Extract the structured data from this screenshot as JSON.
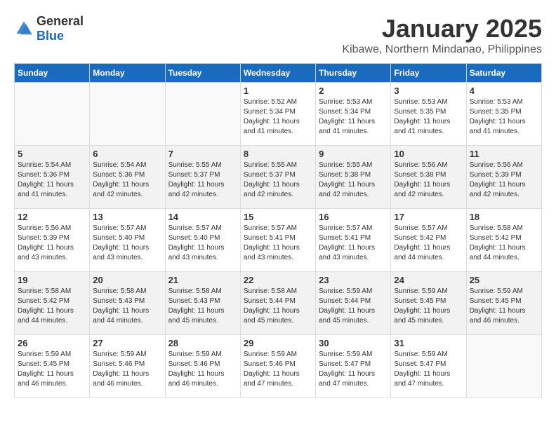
{
  "logo": {
    "text_general": "General",
    "text_blue": "Blue"
  },
  "title": {
    "month": "January 2025",
    "location": "Kibawe, Northern Mindanao, Philippines"
  },
  "weekdays": [
    "Sunday",
    "Monday",
    "Tuesday",
    "Wednesday",
    "Thursday",
    "Friday",
    "Saturday"
  ],
  "weeks": [
    [
      {
        "day": "",
        "sunrise": "",
        "sunset": "",
        "daylight": "",
        "empty": true
      },
      {
        "day": "",
        "sunrise": "",
        "sunset": "",
        "daylight": "",
        "empty": true
      },
      {
        "day": "",
        "sunrise": "",
        "sunset": "",
        "daylight": "",
        "empty": true
      },
      {
        "day": "1",
        "sunrise": "Sunrise: 5:52 AM",
        "sunset": "Sunset: 5:34 PM",
        "daylight": "Daylight: 11 hours and 41 minutes."
      },
      {
        "day": "2",
        "sunrise": "Sunrise: 5:53 AM",
        "sunset": "Sunset: 5:34 PM",
        "daylight": "Daylight: 11 hours and 41 minutes."
      },
      {
        "day": "3",
        "sunrise": "Sunrise: 5:53 AM",
        "sunset": "Sunset: 5:35 PM",
        "daylight": "Daylight: 11 hours and 41 minutes."
      },
      {
        "day": "4",
        "sunrise": "Sunrise: 5:53 AM",
        "sunset": "Sunset: 5:35 PM",
        "daylight": "Daylight: 11 hours and 41 minutes."
      }
    ],
    [
      {
        "day": "5",
        "sunrise": "Sunrise: 5:54 AM",
        "sunset": "Sunset: 5:36 PM",
        "daylight": "Daylight: 11 hours and 41 minutes."
      },
      {
        "day": "6",
        "sunrise": "Sunrise: 5:54 AM",
        "sunset": "Sunset: 5:36 PM",
        "daylight": "Daylight: 11 hours and 42 minutes."
      },
      {
        "day": "7",
        "sunrise": "Sunrise: 5:55 AM",
        "sunset": "Sunset: 5:37 PM",
        "daylight": "Daylight: 11 hours and 42 minutes."
      },
      {
        "day": "8",
        "sunrise": "Sunrise: 5:55 AM",
        "sunset": "Sunset: 5:37 PM",
        "daylight": "Daylight: 11 hours and 42 minutes."
      },
      {
        "day": "9",
        "sunrise": "Sunrise: 5:55 AM",
        "sunset": "Sunset: 5:38 PM",
        "daylight": "Daylight: 11 hours and 42 minutes."
      },
      {
        "day": "10",
        "sunrise": "Sunrise: 5:56 AM",
        "sunset": "Sunset: 5:38 PM",
        "daylight": "Daylight: 11 hours and 42 minutes."
      },
      {
        "day": "11",
        "sunrise": "Sunrise: 5:56 AM",
        "sunset": "Sunset: 5:39 PM",
        "daylight": "Daylight: 11 hours and 42 minutes."
      }
    ],
    [
      {
        "day": "12",
        "sunrise": "Sunrise: 5:56 AM",
        "sunset": "Sunset: 5:39 PM",
        "daylight": "Daylight: 11 hours and 43 minutes."
      },
      {
        "day": "13",
        "sunrise": "Sunrise: 5:57 AM",
        "sunset": "Sunset: 5:40 PM",
        "daylight": "Daylight: 11 hours and 43 minutes."
      },
      {
        "day": "14",
        "sunrise": "Sunrise: 5:57 AM",
        "sunset": "Sunset: 5:40 PM",
        "daylight": "Daylight: 11 hours and 43 minutes."
      },
      {
        "day": "15",
        "sunrise": "Sunrise: 5:57 AM",
        "sunset": "Sunset: 5:41 PM",
        "daylight": "Daylight: 11 hours and 43 minutes."
      },
      {
        "day": "16",
        "sunrise": "Sunrise: 5:57 AM",
        "sunset": "Sunset: 5:41 PM",
        "daylight": "Daylight: 11 hours and 43 minutes."
      },
      {
        "day": "17",
        "sunrise": "Sunrise: 5:57 AM",
        "sunset": "Sunset: 5:42 PM",
        "daylight": "Daylight: 11 hours and 44 minutes."
      },
      {
        "day": "18",
        "sunrise": "Sunrise: 5:58 AM",
        "sunset": "Sunset: 5:42 PM",
        "daylight": "Daylight: 11 hours and 44 minutes."
      }
    ],
    [
      {
        "day": "19",
        "sunrise": "Sunrise: 5:58 AM",
        "sunset": "Sunset: 5:42 PM",
        "daylight": "Daylight: 11 hours and 44 minutes."
      },
      {
        "day": "20",
        "sunrise": "Sunrise: 5:58 AM",
        "sunset": "Sunset: 5:43 PM",
        "daylight": "Daylight: 11 hours and 44 minutes."
      },
      {
        "day": "21",
        "sunrise": "Sunrise: 5:58 AM",
        "sunset": "Sunset: 5:43 PM",
        "daylight": "Daylight: 11 hours and 45 minutes."
      },
      {
        "day": "22",
        "sunrise": "Sunrise: 5:58 AM",
        "sunset": "Sunset: 5:44 PM",
        "daylight": "Daylight: 11 hours and 45 minutes."
      },
      {
        "day": "23",
        "sunrise": "Sunrise: 5:59 AM",
        "sunset": "Sunset: 5:44 PM",
        "daylight": "Daylight: 11 hours and 45 minutes."
      },
      {
        "day": "24",
        "sunrise": "Sunrise: 5:59 AM",
        "sunset": "Sunset: 5:45 PM",
        "daylight": "Daylight: 11 hours and 45 minutes."
      },
      {
        "day": "25",
        "sunrise": "Sunrise: 5:59 AM",
        "sunset": "Sunset: 5:45 PM",
        "daylight": "Daylight: 11 hours and 46 minutes."
      }
    ],
    [
      {
        "day": "26",
        "sunrise": "Sunrise: 5:59 AM",
        "sunset": "Sunset: 5:45 PM",
        "daylight": "Daylight: 11 hours and 46 minutes."
      },
      {
        "day": "27",
        "sunrise": "Sunrise: 5:59 AM",
        "sunset": "Sunset: 5:46 PM",
        "daylight": "Daylight: 11 hours and 46 minutes."
      },
      {
        "day": "28",
        "sunrise": "Sunrise: 5:59 AM",
        "sunset": "Sunset: 5:46 PM",
        "daylight": "Daylight: 11 hours and 46 minutes."
      },
      {
        "day": "29",
        "sunrise": "Sunrise: 5:59 AM",
        "sunset": "Sunset: 5:46 PM",
        "daylight": "Daylight: 11 hours and 47 minutes."
      },
      {
        "day": "30",
        "sunrise": "Sunrise: 5:59 AM",
        "sunset": "Sunset: 5:47 PM",
        "daylight": "Daylight: 11 hours and 47 minutes."
      },
      {
        "day": "31",
        "sunrise": "Sunrise: 5:59 AM",
        "sunset": "Sunset: 5:47 PM",
        "daylight": "Daylight: 11 hours and 47 minutes."
      },
      {
        "day": "",
        "sunrise": "",
        "sunset": "",
        "daylight": "",
        "empty": true
      }
    ]
  ]
}
